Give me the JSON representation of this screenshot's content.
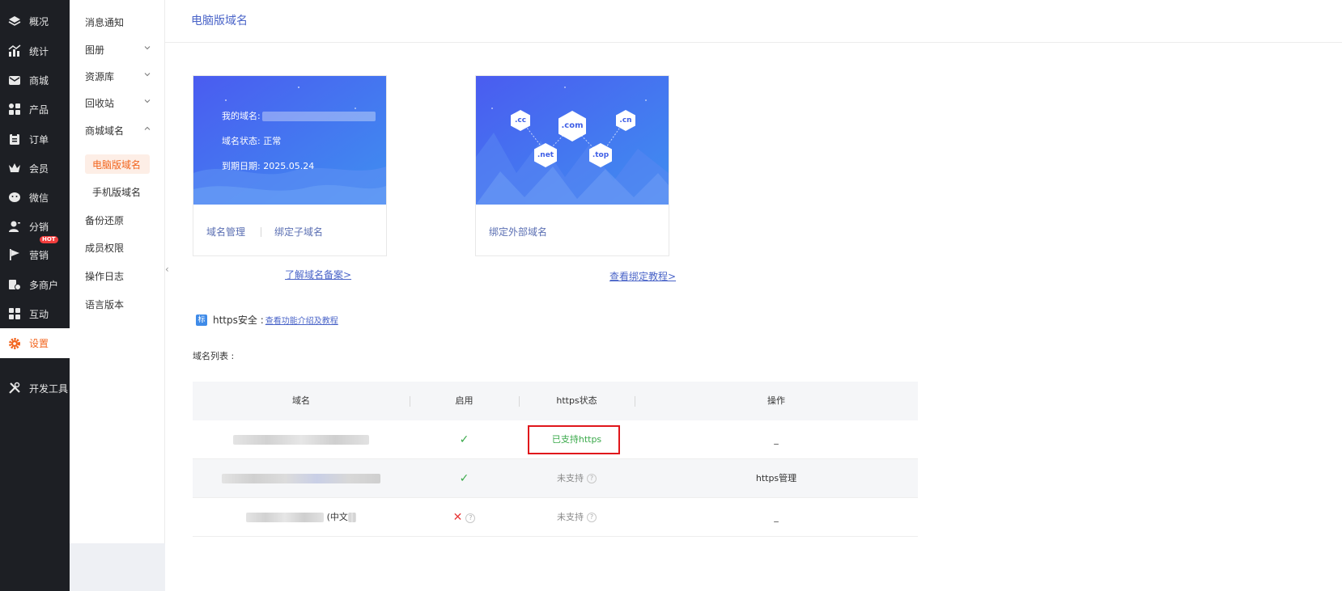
{
  "rail": {
    "items": [
      {
        "label": "概况",
        "icon": "layers-icon"
      },
      {
        "label": "统计",
        "icon": "stats-icon"
      },
      {
        "label": "商城",
        "icon": "mail-icon"
      },
      {
        "label": "产品",
        "icon": "grid-icon"
      },
      {
        "label": "订单",
        "icon": "clipboard-icon"
      },
      {
        "label": "会员",
        "icon": "crown-icon"
      },
      {
        "label": "微信",
        "icon": "wechat-icon"
      },
      {
        "label": "分销",
        "icon": "user-icon"
      },
      {
        "label": "营销",
        "icon": "flag-icon",
        "badge": "HOT"
      },
      {
        "label": "多商户",
        "icon": "store-icon"
      },
      {
        "label": "互动",
        "icon": "apps-icon"
      },
      {
        "label": "设置",
        "icon": "gear-icon"
      },
      {
        "label": "开发工具",
        "icon": "tools-icon"
      }
    ],
    "active_color": "#f2651e"
  },
  "submenu": {
    "items": [
      {
        "label": "消息通知"
      },
      {
        "label": "图册"
      },
      {
        "label": "资源库"
      },
      {
        "label": "回收站"
      },
      {
        "label": "商城域名"
      },
      {
        "label": "电脑版域名"
      },
      {
        "label": "手机版域名"
      },
      {
        "label": "备份还原"
      },
      {
        "label": "成员权限"
      },
      {
        "label": "操作日志"
      },
      {
        "label": "语言版本"
      }
    ]
  },
  "header": {
    "title": "电脑版域名"
  },
  "card1": {
    "domain_label": "我的域名:",
    "status_label": "域名状态:",
    "status_value": "正常",
    "expiry_label": "到期日期:",
    "expiry_value": "2025.05.24",
    "link1": "域名管理",
    "link2": "绑定子域名",
    "below_link": "了解域名备案>"
  },
  "card2": {
    "tlds": [
      ".cc",
      ".com",
      ".cn",
      ".net",
      ".top"
    ],
    "link1": "绑定外部域名",
    "below_link": "查看绑定教程>"
  },
  "https": {
    "tag": "标",
    "label": "https安全 :",
    "link": "查看功能介绍及教程"
  },
  "list": {
    "title": "域名列表 :",
    "columns": [
      "域名",
      "启用",
      "https状态",
      "操作"
    ],
    "rows": [
      {
        "domain_suffix": "",
        "enabled": "✓",
        "https": "已支持https",
        "https_state": "supported",
        "action": "_"
      },
      {
        "domain_suffix": "",
        "enabled": "✓",
        "https": "未支持",
        "https_state": "unsupported",
        "action": "https管理"
      },
      {
        "domain_suffix": "(中文",
        "enabled": "✕",
        "https": "未支持",
        "https_state": "unsupported",
        "action": "_"
      }
    ],
    "help_mark": "?"
  },
  "colors": {
    "brand_blue": "#4a64c8",
    "hero_start": "#4a5cf0",
    "hero_end": "#3f8ff0",
    "success": "#3aa94a",
    "danger": "#e83a3a",
    "highlight_box": "#e0161b"
  }
}
